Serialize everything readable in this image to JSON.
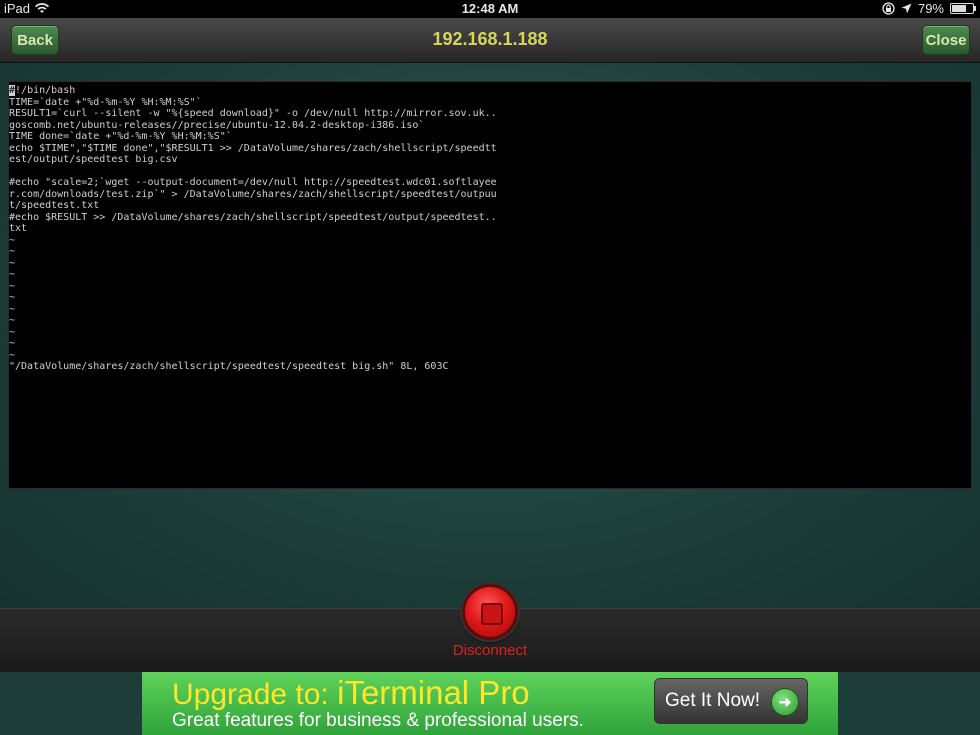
{
  "status_bar": {
    "device": "iPad",
    "time": "12:48 AM",
    "battery": "79%",
    "battery_level": 0.79
  },
  "nav": {
    "back_label": "Back",
    "title": "192.168.1.188",
    "close_label": "Close"
  },
  "terminal": {
    "cursor_char": "#",
    "lines_after_cursor": "!/bin/bash\nTIME=`date +\"%d-%m-%Y %H:%M:%S\"`\nRESULT1=`curl --silent -w \"%{speed download}\" -o /dev/null http://mirror.sov.uk..\ngoscomb.net/ubuntu-releases//precise/ubuntu-12.04.2-desktop-i386.iso`\nTIME done=`date +\"%d-%m-%Y %H:%M:%S\"`\necho $TIME\",\"$TIME done\",\"$RESULT1 >> /DataVolume/shares/zach/shellscript/speedtt\nest/output/speedtest big.csv\n\n#echo \"scale=2;`wget --output-document=/dev/null http://speedtest.wdc01.softlayee\nr.com/downloads/test.zip`\" > /DataVolume/shares/zach/shellscript/speedtest/outpuu\nt/speedtest.txt\n#echo $RESULT >> /DataVolume/shares/zach/shellscript/speedtest/output/speedtest..\ntxt\n~\n~\n~\n~\n~\n~\n~\n~\n~\n~\n~\n\"/DataVolume/shares/zach/shellscript/speedtest/speedtest big.sh\" 8L, 603C"
  },
  "controls": {
    "disconnect_label": "Disconnect"
  },
  "ad": {
    "headline_prefix": "Upgrade to: ",
    "headline_product": "iTerminal Pro",
    "subline": "Great features for business & professional users.",
    "cta_label": "Get It Now!",
    "cta_icon": "arrow-right-icon"
  }
}
